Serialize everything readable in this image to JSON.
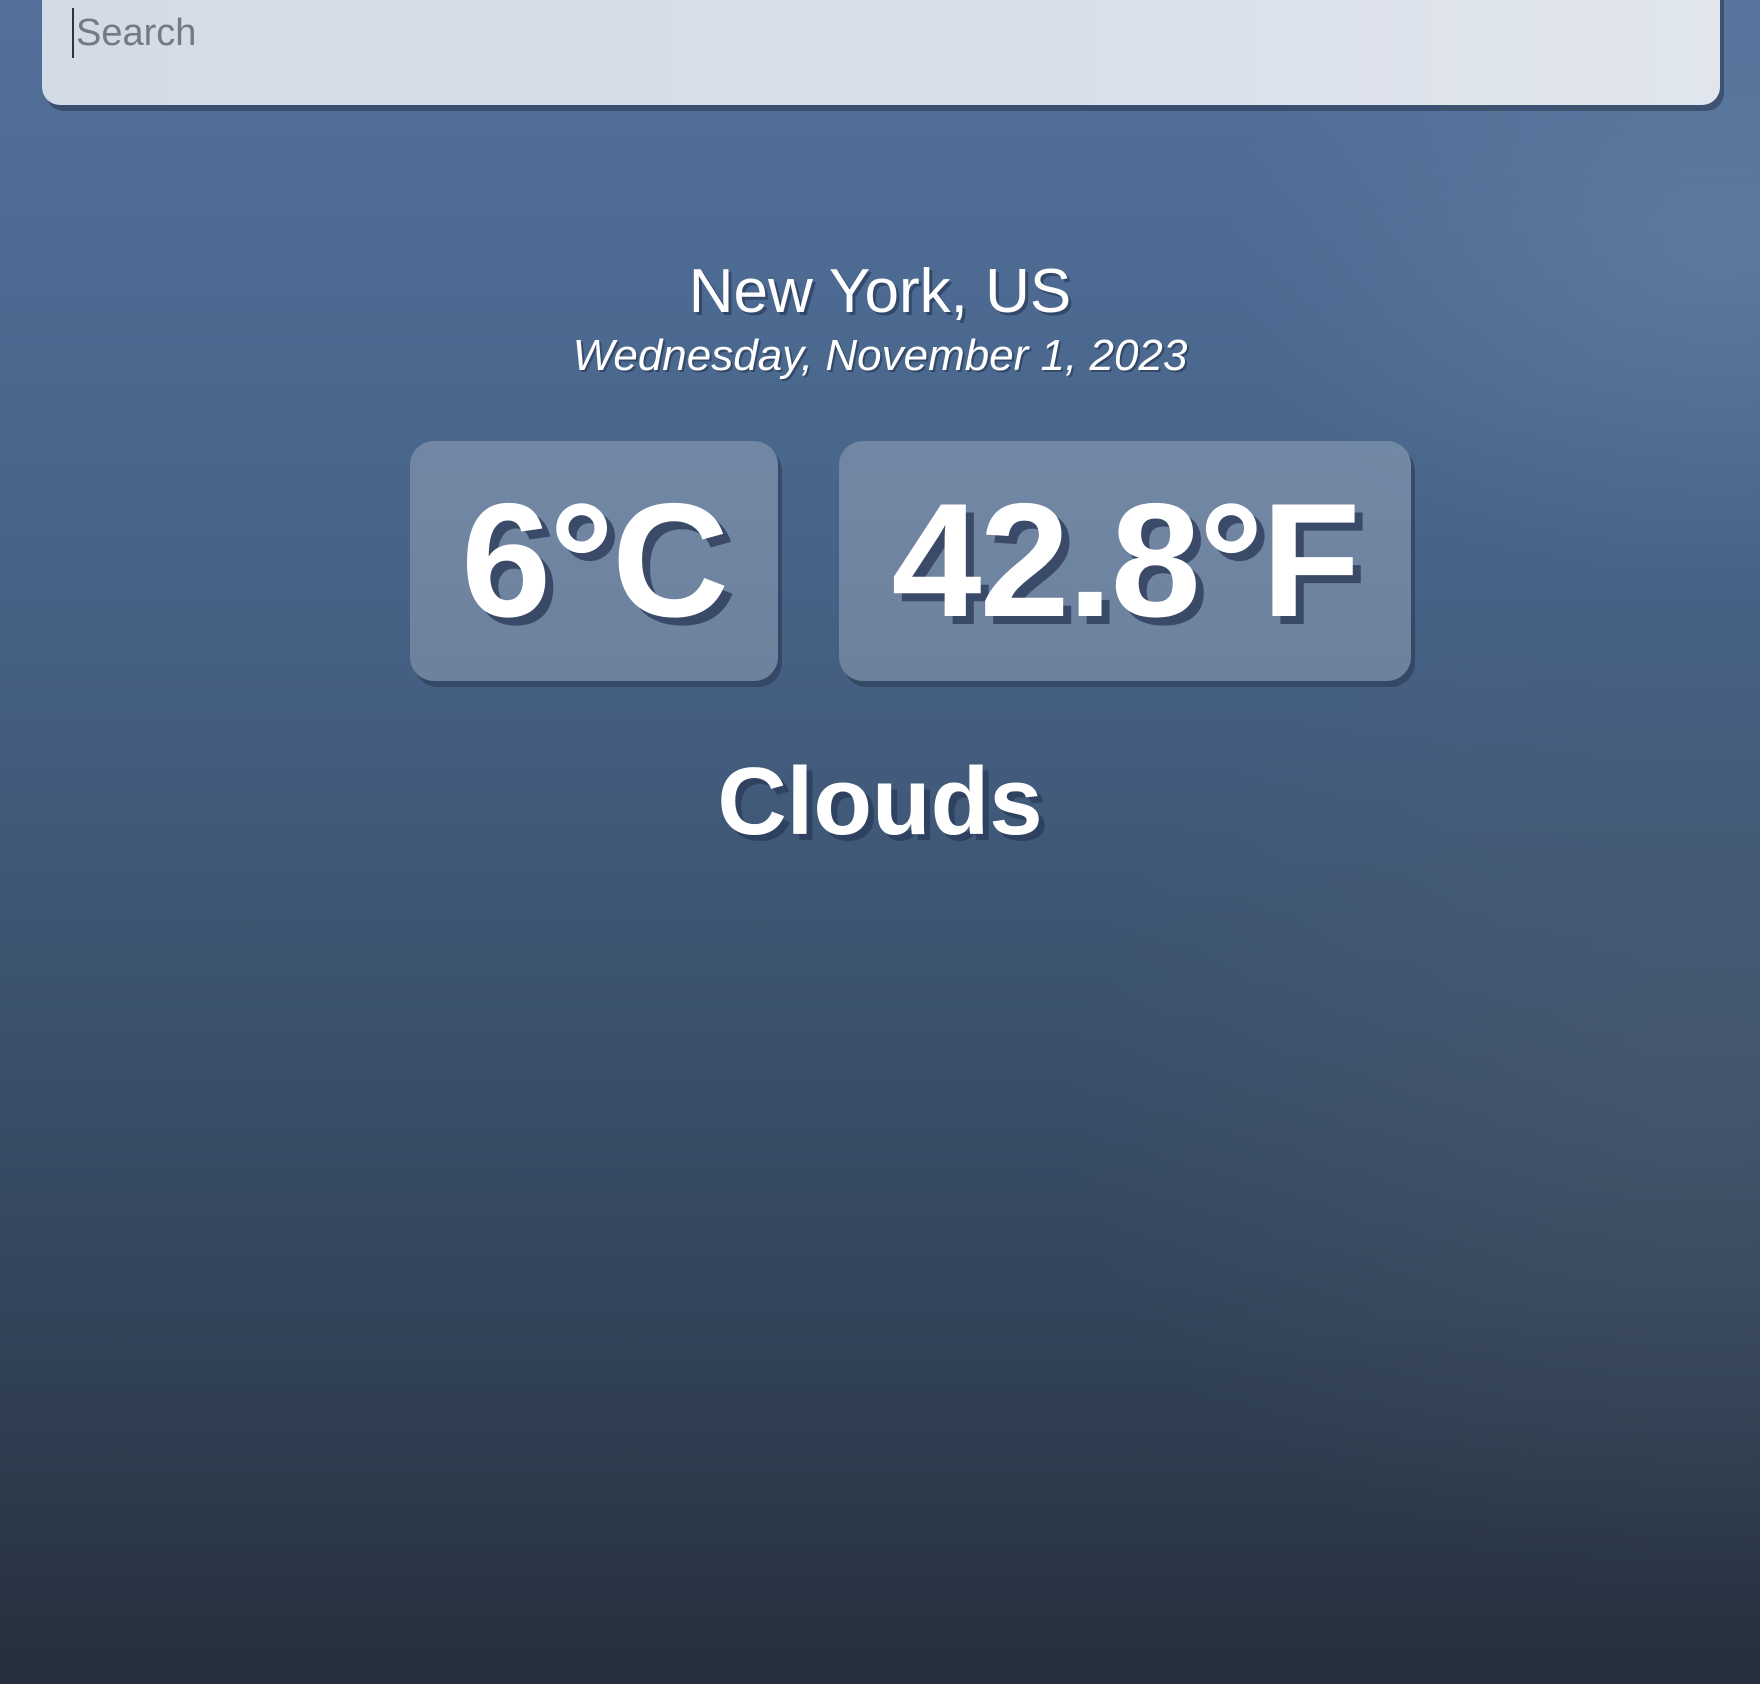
{
  "search": {
    "placeholder": "Search",
    "value": ""
  },
  "location": {
    "name": "New York, US",
    "date": "Wednesday, November 1, 2023"
  },
  "weather": {
    "temp_c": "6°C",
    "temp_f": "42.8°F",
    "condition": "Clouds"
  },
  "colors": {
    "background_top": "#527099",
    "background_bottom": "#252f3c",
    "search_bar": "#d9dfe9",
    "text": "#ffffff"
  }
}
